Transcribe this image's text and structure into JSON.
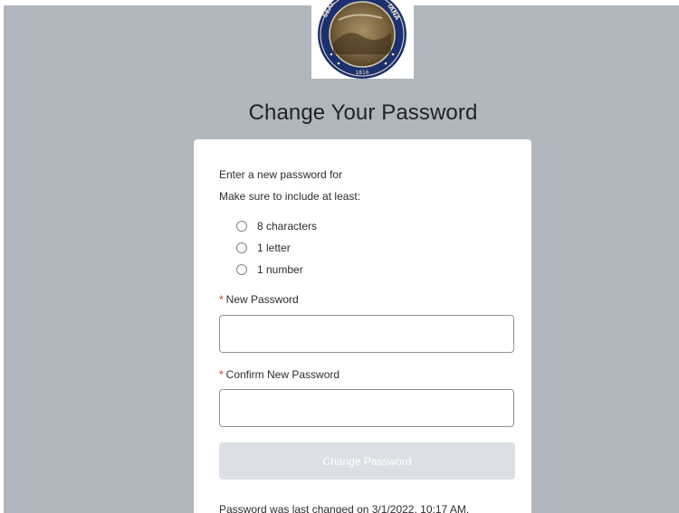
{
  "header": {
    "logo_icon": "state-seal-logo",
    "logo_text": "SEAL OF THE STATE OF INDIANA",
    "logo_year": "1816",
    "title": "Change Your Password"
  },
  "form": {
    "intro_line1": "Enter a new password for",
    "intro_line2": "Make sure to include at least:",
    "requirements": [
      {
        "label": "8 characters"
      },
      {
        "label": "1 letter"
      },
      {
        "label": "1 number"
      }
    ],
    "required_marker": "*",
    "new_password_label": "New Password",
    "new_password_value": "",
    "confirm_password_label": "Confirm New Password",
    "confirm_password_value": "",
    "submit_label": "Change Password",
    "footer_note": "Password was last changed on 3/1/2022, 10:17 AM."
  },
  "colors": {
    "backdrop": "#b0b6bd",
    "card": "#ffffff",
    "required": "#c23934",
    "button_disabled": "#dcdfe6"
  }
}
